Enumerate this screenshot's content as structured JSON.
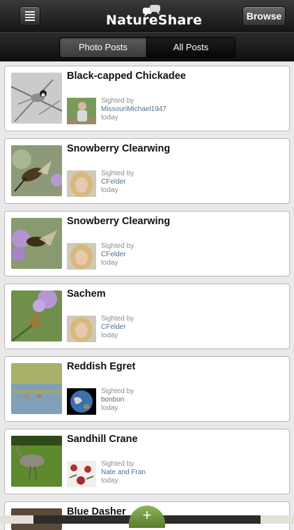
{
  "header": {
    "app_name": "NatureShare",
    "browse_label": "Browse"
  },
  "tabs": [
    {
      "label": "Photo Posts",
      "active": true
    },
    {
      "label": "All Posts",
      "active": false
    }
  ],
  "posts": [
    {
      "title": "Black-capped Chickadee",
      "sighted_label": "Sighted by",
      "user": "MissouriMichael1947",
      "when": "today"
    },
    {
      "title": "Snowberry Clearwing",
      "sighted_label": "Sighted by",
      "user": "CFelder",
      "when": "today"
    },
    {
      "title": "Snowberry Clearwing",
      "sighted_label": "Sighted by",
      "user": "CFelder",
      "when": "today"
    },
    {
      "title": "Sachem",
      "sighted_label": "Sighted by",
      "user": "CFelder",
      "when": "today"
    },
    {
      "title": "Reddish Egret",
      "sighted_label": "Sighted by",
      "user": "bonbon",
      "when": "today"
    },
    {
      "title": "Sandhill Crane",
      "sighted_label": "Sighted by",
      "user": "Nate and Fran",
      "when": "today"
    },
    {
      "title": "Blue Dasher"
    }
  ],
  "fab": {
    "label": "+"
  },
  "colors": {
    "accent_link": "#4e6f8e",
    "fab_green": "#6f9440"
  }
}
